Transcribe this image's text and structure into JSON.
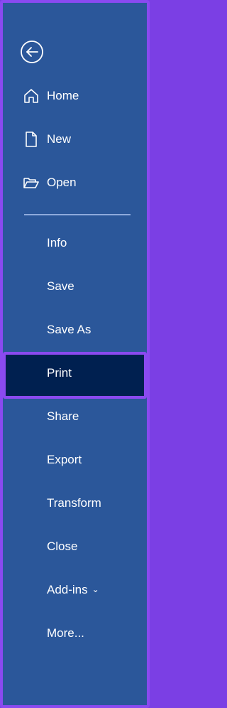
{
  "menu": {
    "back_icon": "back-arrow-circle-icon",
    "top_items": [
      {
        "label": "Home",
        "icon": "home-icon"
      },
      {
        "label": "New",
        "icon": "new-document-icon"
      },
      {
        "label": "Open",
        "icon": "open-folder-icon"
      }
    ],
    "items": [
      {
        "label": "Info"
      },
      {
        "label": "Save"
      },
      {
        "label": "Save As"
      },
      {
        "label": "Print",
        "selected": true
      },
      {
        "label": "Share"
      },
      {
        "label": "Export"
      },
      {
        "label": "Transform"
      },
      {
        "label": "Close"
      },
      {
        "label": "Add-ins",
        "has_dropdown": true
      },
      {
        "label": "More..."
      }
    ]
  },
  "colors": {
    "background": "#2b579a",
    "selected_background": "#002050",
    "highlight_border": "#8a4af0",
    "text": "#ffffff"
  }
}
